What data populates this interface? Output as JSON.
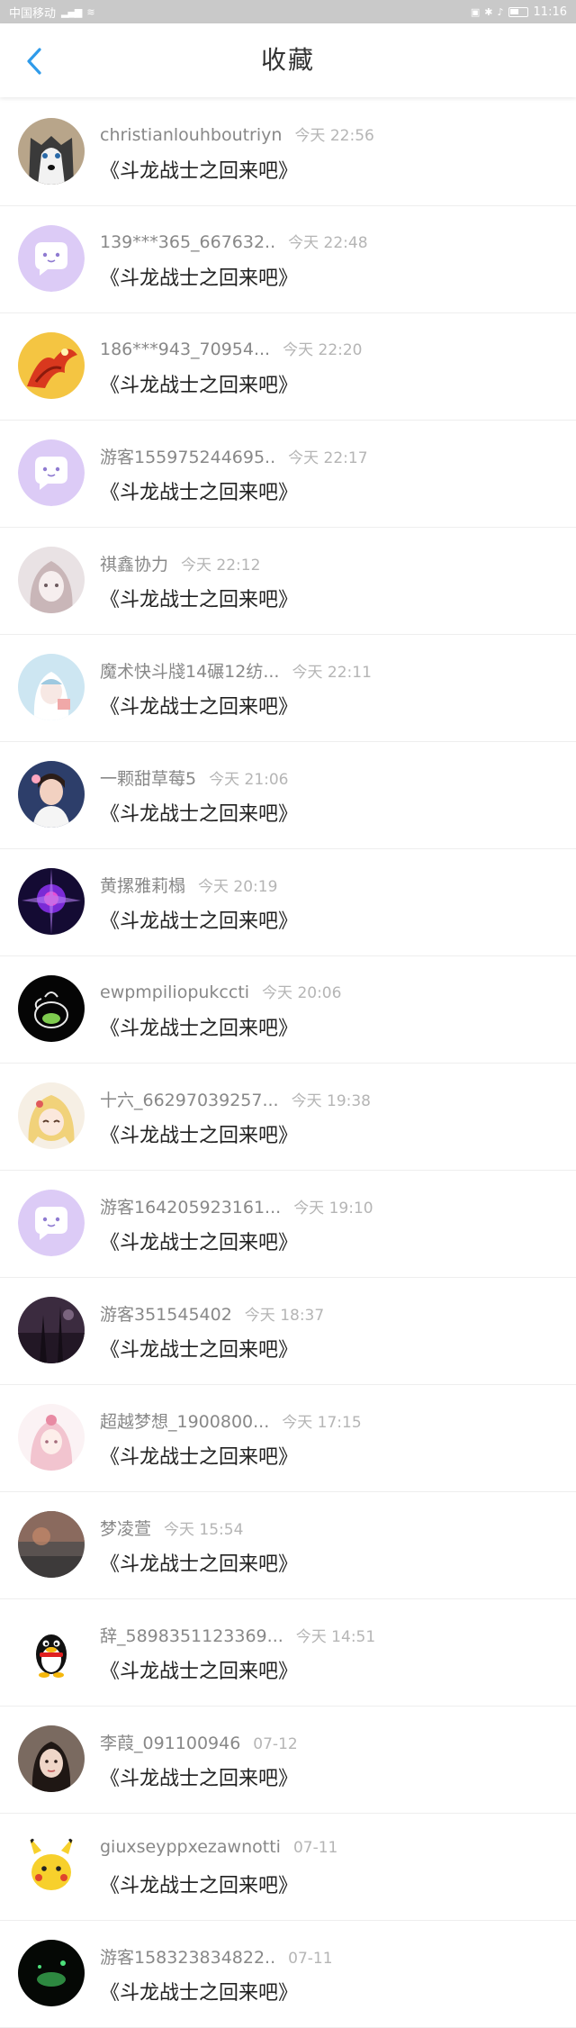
{
  "status_bar": {
    "carrier": "中国移动",
    "time": "11:16"
  },
  "header": {
    "title": "收藏"
  },
  "items": [
    {
      "username": "christianlouhboutriyn",
      "time": "今天 22:56",
      "content": "《斗龙战士之回来吧》",
      "avatar": "husky-dog"
    },
    {
      "username": "139***365_667632..",
      "time": "今天 22:48",
      "content": "《斗龙战士之回来吧》",
      "avatar": "default-chat"
    },
    {
      "username": "186***943_70954...",
      "time": "今天 22:20",
      "content": "《斗龙战士之回来吧》",
      "avatar": "phoenix"
    },
    {
      "username": "游客155975244695..",
      "time": "今天 22:17",
      "content": "《斗龙战士之回来吧》",
      "avatar": "default-chat"
    },
    {
      "username": "祺鑫协力",
      "time": "今天 22:12",
      "content": "《斗龙战士之回来吧》",
      "avatar": "anime-girl-pale"
    },
    {
      "username": "魔术快斗牋14碾12纺...",
      "time": "今天 22:11",
      "content": "《斗龙战士之回来吧》",
      "avatar": "anime-girl-blue"
    },
    {
      "username": "一颗甜草莓5",
      "time": "今天 21:06",
      "content": "《斗龙战士之回来吧》",
      "avatar": "girl-photo"
    },
    {
      "username": "黄摞雅莉榻",
      "time": "今天 20:19",
      "content": "《斗龙战士之回来吧》",
      "avatar": "purple-glow"
    },
    {
      "username": "ewpmpiliopukccti",
      "time": "今天 20:06",
      "content": "《斗龙战士之回来吧》",
      "avatar": "glass-teapot"
    },
    {
      "username": "十六_66297039257...",
      "time": "今天 19:38",
      "content": "《斗龙战士之回来吧》",
      "avatar": "anime-blonde"
    },
    {
      "username": "游客164205923161...",
      "time": "今天 19:10",
      "content": "《斗龙战士之回来吧》",
      "avatar": "default-chat"
    },
    {
      "username": "游客351545402",
      "time": "今天 18:37",
      "content": "《斗龙战士之回来吧》",
      "avatar": "dark-forest"
    },
    {
      "username": "超越梦想_1900800...",
      "time": "今天 17:15",
      "content": "《斗龙战士之回来吧》",
      "avatar": "anime-pink"
    },
    {
      "username": "梦凌萱",
      "time": "今天 15:54",
      "content": "《斗龙战士之回来吧》",
      "avatar": "sunset-haze"
    },
    {
      "username": "辞_5898351123369...",
      "time": "今天 14:51",
      "content": "《斗龙战士之回来吧》",
      "avatar": "qq-penguin"
    },
    {
      "username": "李葭_091100946",
      "time": "07-12",
      "content": "《斗龙战士之回来吧》",
      "avatar": "woman-photo"
    },
    {
      "username": "giuxseyppxezawnotti",
      "time": "07-11",
      "content": "《斗龙战士之回来吧》",
      "avatar": "pikachu"
    },
    {
      "username": "游客158323834822..",
      "time": "07-11",
      "content": "《斗龙战士之回来吧》",
      "avatar": "dark-green-scene"
    }
  ],
  "colors": {
    "accent": "#2f9bea",
    "default_avatar_bg": "#d9c8f5"
  }
}
